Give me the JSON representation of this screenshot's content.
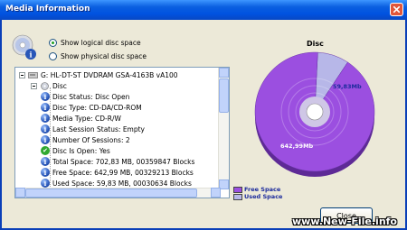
{
  "window": {
    "title": "Media Information"
  },
  "options": [
    {
      "label": "Show logical disc space",
      "checked": true
    },
    {
      "label": "Show physical disc space",
      "checked": false
    }
  ],
  "tree": {
    "drive": "G:  HL-DT-ST  DVDRAM GSA-4163B  vA100",
    "disc": "Disc",
    "items": [
      {
        "icon": "info-icon",
        "text": "Disc Status: Disc Open"
      },
      {
        "icon": "info-icon",
        "text": "Disc Type: CD-DA/CD-ROM"
      },
      {
        "icon": "info-icon",
        "text": "Media Type: CD-R/W"
      },
      {
        "icon": "info-icon",
        "text": "Last Session Status: Empty"
      },
      {
        "icon": "info-icon",
        "text": "Number Of Sessions: 2"
      },
      {
        "icon": "check-icon",
        "text": "Disc Is Open: Yes"
      },
      {
        "icon": "info-icon",
        "text": "Total Space: 702,83 MB, 00359847 Blocks"
      },
      {
        "icon": "info-icon",
        "text": "Free Space: 642,99 MB, 00329213 Blocks"
      },
      {
        "icon": "info-icon",
        "text": "Used Space: 59,83 MB, 00030634 Blocks"
      }
    ]
  },
  "chart_data": {
    "type": "pie",
    "title": "Disc",
    "categories": [
      "Free Space",
      "Used Space"
    ],
    "values": [
      642.99,
      59.83
    ],
    "labels": [
      "642,99Mb",
      "59,83Mb"
    ],
    "colors": [
      "#9b4fe0",
      "#b7b7e8"
    ]
  },
  "legend": [
    {
      "label": "Free Space",
      "color": "#9b4fe0"
    },
    {
      "label": "Used Space",
      "color": "#b7b7e8"
    }
  ],
  "buttons": {
    "close": "Close"
  },
  "watermark": "www.New-File.info"
}
